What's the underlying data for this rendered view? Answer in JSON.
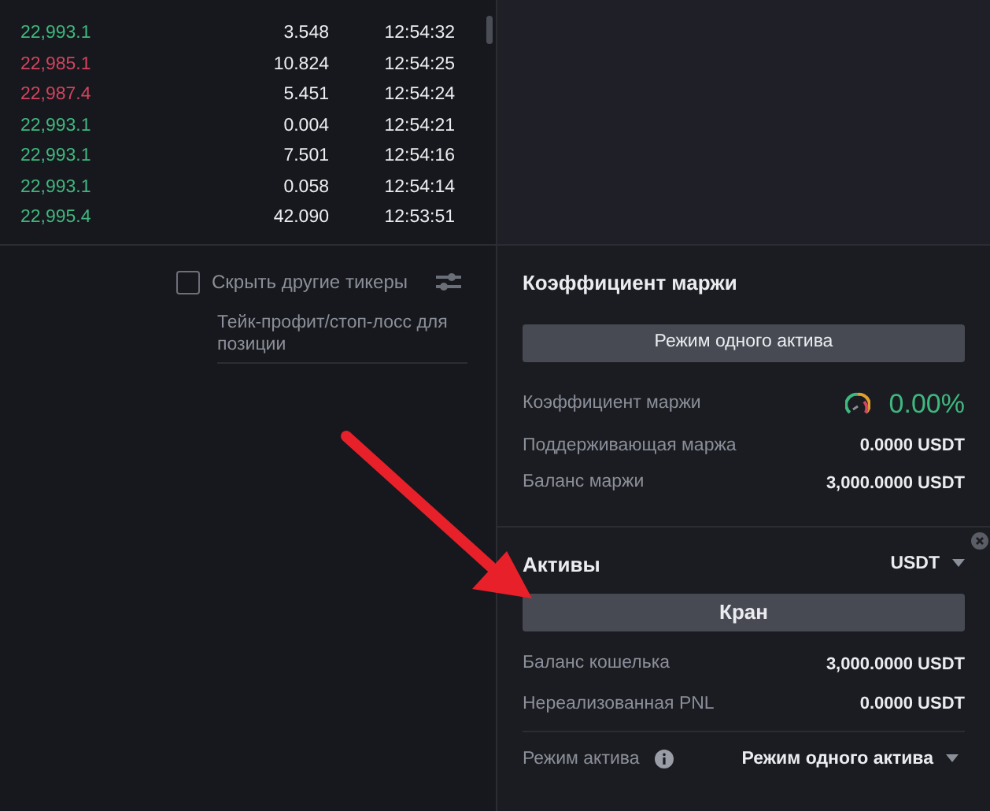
{
  "trades": [
    {
      "price": "22,993.1",
      "color": "#3fb87f",
      "amount": "3.548",
      "time": "12:54:32"
    },
    {
      "price": "22,985.1",
      "color": "#d2445f",
      "amount": "10.824",
      "time": "12:54:25"
    },
    {
      "price": "22,987.4",
      "color": "#d2445f",
      "amount": "5.451",
      "time": "12:54:24"
    },
    {
      "price": "22,993.1",
      "color": "#3fb87f",
      "amount": "0.004",
      "time": "12:54:21"
    },
    {
      "price": "22,993.1",
      "color": "#3fb87f",
      "amount": "7.501",
      "time": "12:54:16"
    },
    {
      "price": "22,993.1",
      "color": "#3fb87f",
      "amount": "0.058",
      "time": "12:54:14"
    },
    {
      "price": "22,995.4",
      "color": "#3fb87f",
      "amount": "42.090",
      "time": "12:53:51"
    }
  ],
  "positions": {
    "hide_other_tickers": {
      "label": "Скрыть другие тикеры",
      "checked": false
    },
    "column_tpsl": "Тейк-профит/стоп-лосс для позиции"
  },
  "margin": {
    "title": "Коэффициент маржи",
    "mode_button": "Режим одного актива",
    "rows": [
      {
        "kind": "ratio",
        "label": "Коэффициент маржи",
        "value": "0.00%"
      },
      {
        "kind": "plain",
        "label": "Поддерживающая маржа",
        "value": "0.0000 USDT"
      },
      {
        "kind": "plain",
        "label": "Баланс маржи",
        "value": "3,000.0000 USDT"
      }
    ]
  },
  "assets": {
    "title": "Активы",
    "currency": "USDT",
    "faucet_button": "Кран",
    "rows": [
      {
        "label": "Баланс кошелька",
        "value": "3,000.0000 USDT"
      },
      {
        "label": "Нереализованная PNL",
        "value": "0.0000 USDT"
      }
    ],
    "asset_mode": {
      "label": "Режим актива",
      "value": "Режим одного актива"
    }
  }
}
